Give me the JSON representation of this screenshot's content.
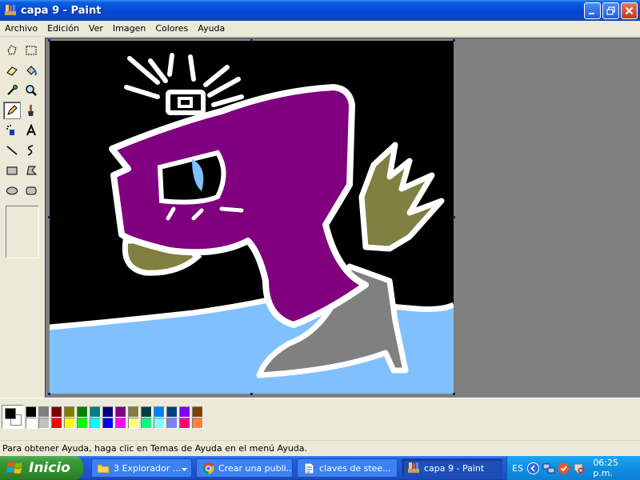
{
  "window": {
    "title": "capa 9 - Paint"
  },
  "menu": {
    "items": [
      "Archivo",
      "Edición",
      "Ver",
      "Imagen",
      "Colores",
      "Ayuda"
    ]
  },
  "tools": [
    "free-select",
    "rect-select",
    "eraser",
    "fill-bucket",
    "color-picker",
    "magnifier",
    "pencil",
    "brush",
    "airbrush",
    "text",
    "line",
    "curve",
    "rectangle",
    "polygon",
    "ellipse",
    "rounded-rectangle"
  ],
  "palette": {
    "foreground": "#000000",
    "background": "#ffffff",
    "row1": [
      "#000000",
      "#808080",
      "#800000",
      "#808000",
      "#008000",
      "#008080",
      "#000080",
      "#800080",
      "#808040",
      "#004040",
      "#0080ff",
      "#004080",
      "#8000ff",
      "#804000"
    ],
    "row2": [
      "#ffffff",
      "#c0c0c0",
      "#ff0000",
      "#ffff00",
      "#00ff00",
      "#00ffff",
      "#0000ff",
      "#ff00ff",
      "#ffff80",
      "#00ff80",
      "#80ffff",
      "#8080ff",
      "#ff0080",
      "#ff8040"
    ]
  },
  "canvas_colors": {
    "sky": "#000000",
    "ground": "#80c0ff",
    "body": "#800080",
    "wing": "#808040",
    "heel": "#808080",
    "outline": "#ffffff"
  },
  "status": {
    "text": "Para obtener Ayuda, haga clic en Temas de Ayuda en el menú Ayuda."
  },
  "taskbar": {
    "start_label": "Inicio",
    "tasks": [
      {
        "label": "3 Explorador ..."
      },
      {
        "label": "Crear una publi..."
      },
      {
        "label": "claves de stee..."
      },
      {
        "label": "capa 9 - Paint"
      }
    ],
    "language": "ES",
    "clock": "06:25 p.m."
  }
}
